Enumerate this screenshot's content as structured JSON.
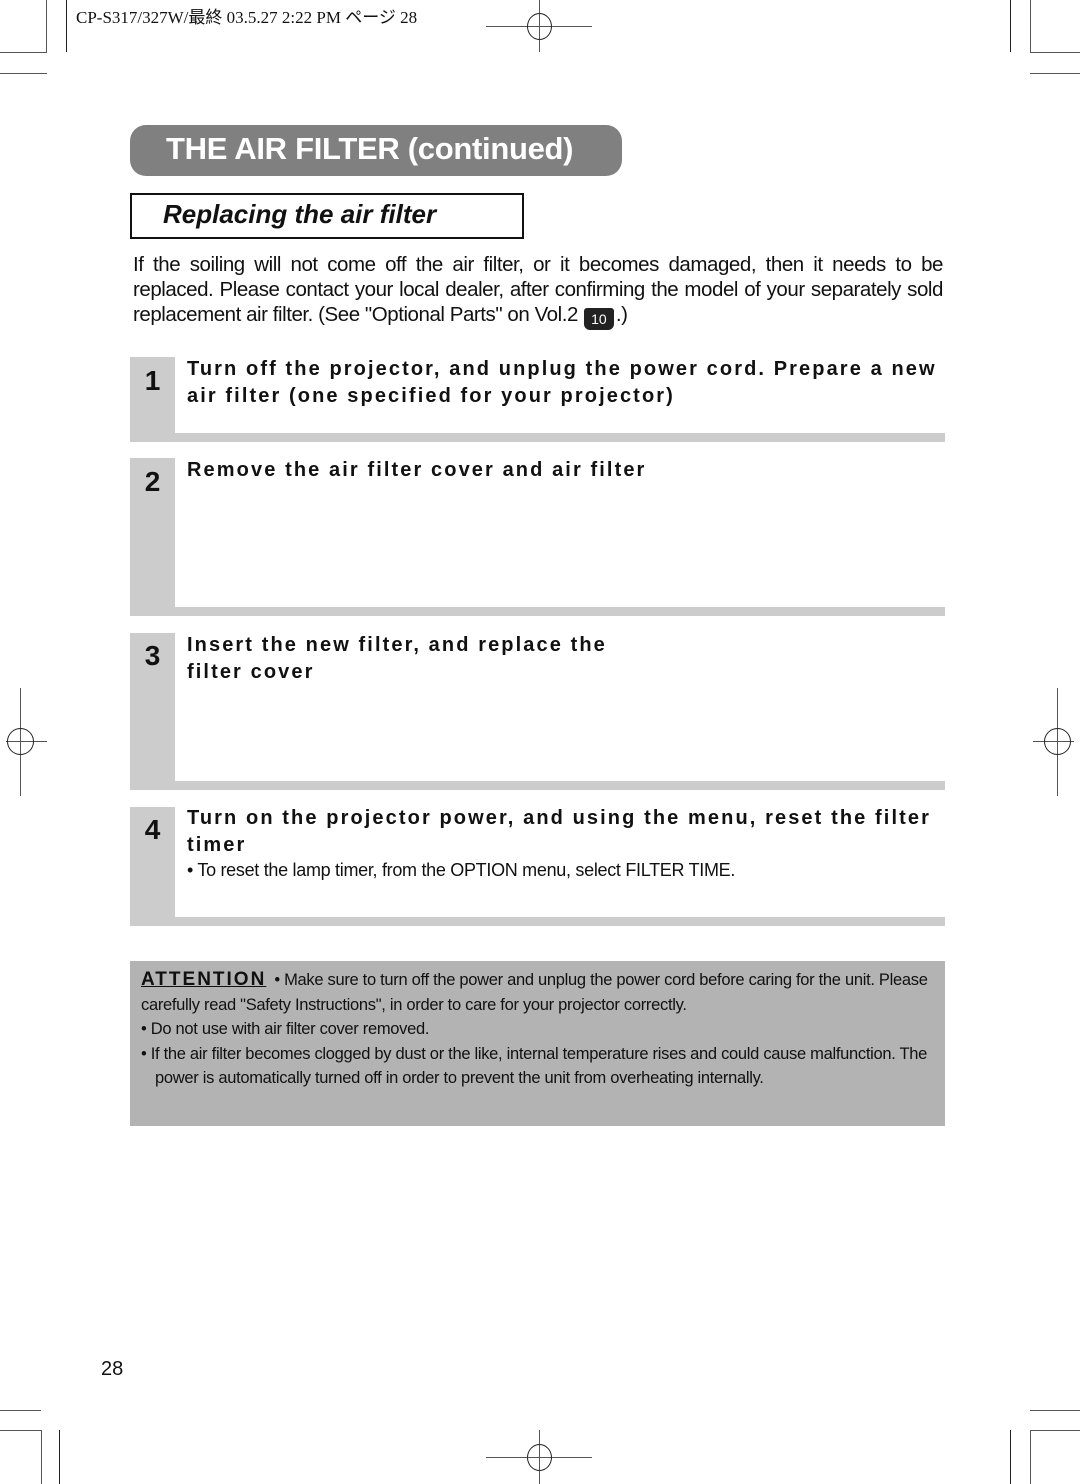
{
  "print_header": {
    "text": "CP-S317/327W/最終  03.5.27 2:22 PM  ページ 28"
  },
  "section_title": "THE AIR FILTER (continued)",
  "subsection_title": "Replacing the air filter",
  "intro": {
    "text": "If the soiling will not come off the air filter, or it becomes damaged, then it needs to be replaced. Please contact your local dealer, after confirming the model of your separately sold replacement air filter. (See \"Optional Parts\" on Vol.2",
    "ref_icon": "book-icon",
    "ref_page": "10",
    "suffix": ".)"
  },
  "steps": [
    {
      "number": "1",
      "heading": "Turn off the projector, and unplug the power cord. Prepare a new air filter (one specified for your projector)"
    },
    {
      "number": "2",
      "heading": "Remove the air filter cover and air filter"
    },
    {
      "number": "3",
      "heading_line1": "Insert the new filter, and replace the",
      "heading_line2": "filter cover"
    },
    {
      "number": "4",
      "heading": "Turn on the projector power, and using the menu, reset the filter timer",
      "note": "• To reset the lamp timer, from the OPTION menu, select FILTER TIME."
    }
  ],
  "attention": {
    "label": "ATTENTION",
    "lead": "• Make sure to turn off the power and unplug the power cord before caring for the unit. Please carefully read \"Safety Instructions\", in order to care for your projector correctly.",
    "bullets": [
      "• Do not use with air filter cover removed.",
      "• If the air filter becomes clogged by dust or the like, internal temperature rises and could cause malfunction. The power is automatically turned off in order to prevent the unit from overheating internally."
    ]
  },
  "page_number": "28",
  "colors": {
    "title_pill": "#808080",
    "step_gray": "#cccccc",
    "attention_bg": "#b3b3b3"
  }
}
